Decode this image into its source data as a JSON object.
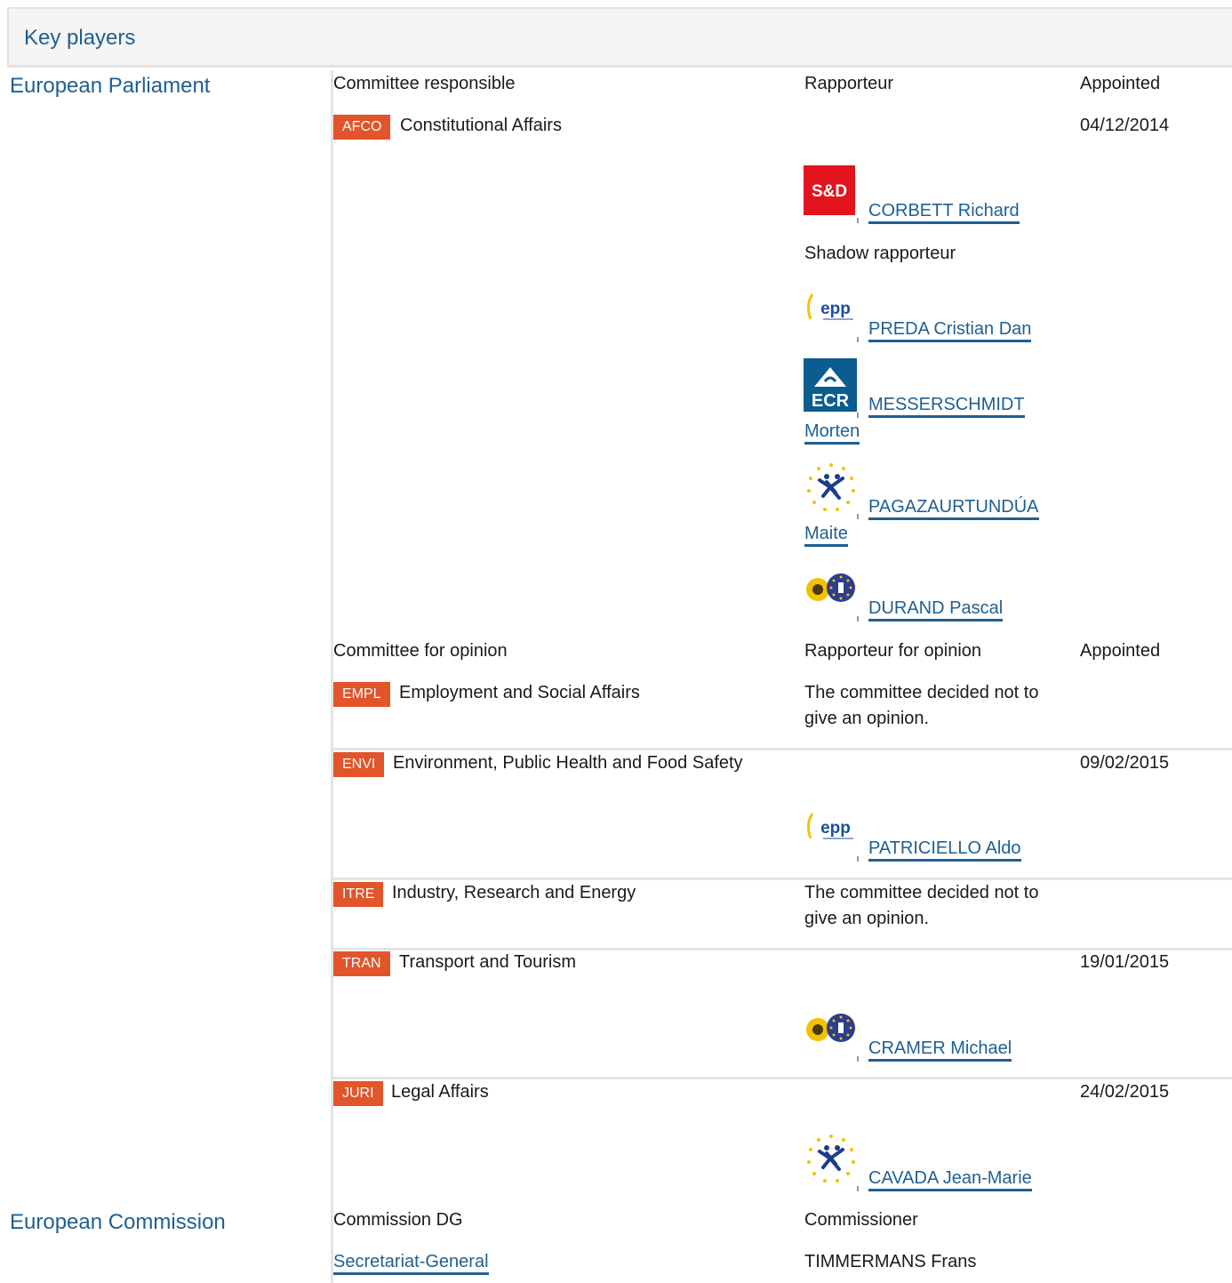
{
  "header": {
    "title": "Key players"
  },
  "parliament": {
    "title": "European Parliament",
    "responsible": {
      "col_committee": "Committee responsible",
      "col_rapporteur": "Rapporteur",
      "col_appointed": "Appointed",
      "committee_code": "AFCO",
      "committee_name": "Constitutional Affairs",
      "appointed": "04/12/2014",
      "rapporteur": {
        "group_logo": "S&D",
        "name": "CORBETT Richard"
      },
      "shadow_label": "Shadow rapporteur",
      "shadows": [
        {
          "group_logo": "epp",
          "name": "PREDA Cristian Dan"
        },
        {
          "group_logo": "ECR",
          "name_line1": "MESSERSCHMIDT",
          "name_line2": "Morten"
        },
        {
          "group_logo": "ALDE",
          "name_line1": "PAGAZAURTUNDÚA",
          "name_line2": "Maite"
        },
        {
          "group_logo": "Greens/EFA",
          "name": "DURAND Pascal"
        }
      ]
    },
    "opinion": {
      "col_committee": "Committee for opinion",
      "col_rapporteur": "Rapporteur for opinion",
      "col_appointed": "Appointed",
      "rows": [
        {
          "code": "EMPL",
          "name": "Employment and Social Affairs",
          "note_line1": "The committee decided not to",
          "note_line2": "give an opinion."
        },
        {
          "code": "ENVI",
          "name": "Environment, Public Health and Food Safety",
          "appointed": "09/02/2015",
          "rapporteur": "PATRICIELLO Aldo",
          "group_logo": "epp"
        },
        {
          "code": "ITRE",
          "name": "Industry, Research and Energy",
          "note_line1": "The committee decided not to",
          "note_line2": "give an opinion."
        },
        {
          "code": "TRAN",
          "name": "Transport and Tourism",
          "appointed": "19/01/2015",
          "rapporteur": "CRAMER Michael",
          "group_logo": "Greens/EFA"
        },
        {
          "code": "JURI",
          "name": "Legal Affairs",
          "appointed": "24/02/2015",
          "rapporteur": "CAVADA Jean-Marie",
          "group_logo": "ALDE"
        }
      ]
    }
  },
  "commission": {
    "title": "European Commission",
    "col_dg": "Commission DG",
    "col_commissioner": "Commissioner",
    "dg": "Secretariat-General",
    "commissioner": "TIMMERMANS Frans"
  },
  "colors": {
    "link": "#1f5f93",
    "badge": "#e2542a",
    "header_bg": "#f5f5f5"
  }
}
